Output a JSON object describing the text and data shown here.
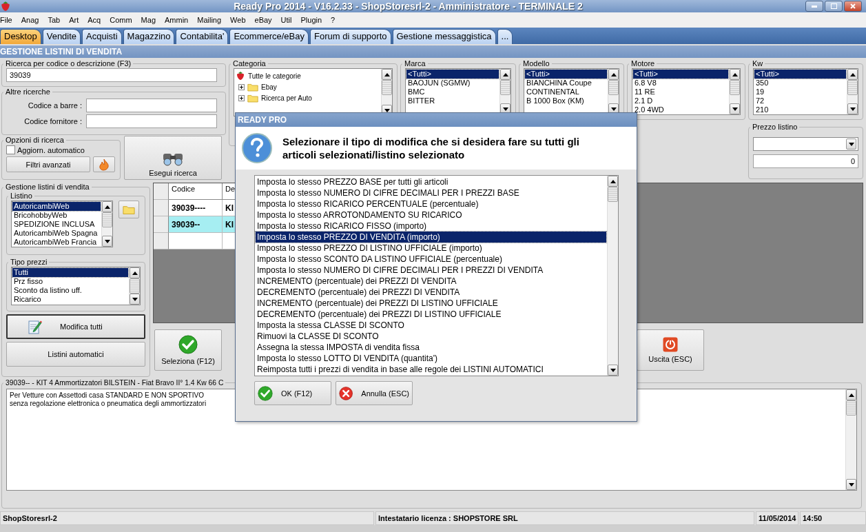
{
  "window": {
    "title": "Ready Pro 2014 - V16.2.33 - ShopStoresrl-2 - Amministratore - TERMINALE 2"
  },
  "menu": [
    "File",
    "Anag",
    "Tab",
    "Art",
    "Acq",
    "Comm",
    "Mag",
    "Ammin",
    "Mailing",
    "Web",
    "eBay",
    "Util",
    "Plugin",
    "?"
  ],
  "tabs": [
    {
      "label": "Desktop",
      "selected": true
    },
    {
      "label": "Vendite",
      "selected": false
    },
    {
      "label": "Acquisti",
      "selected": false
    },
    {
      "label": "Magazzino",
      "selected": false
    },
    {
      "label": "Contabilita'",
      "selected": false
    },
    {
      "label": "Ecommerce/eBay",
      "selected": false
    },
    {
      "label": "Forum di supporto",
      "selected": false
    },
    {
      "label": "Gestione messaggistica",
      "selected": false
    },
    {
      "label": "...",
      "selected": false
    }
  ],
  "section_title": "GESTIONE LISTINI DI VENDITA",
  "search": {
    "label": "Ricerca per codice o descrizione (F3)",
    "value": "39039"
  },
  "other_searches": {
    "label": "Altre ricerche",
    "fields": [
      {
        "label": "Codice a barre :"
      },
      {
        "label": "Codice fornitore :"
      }
    ]
  },
  "search_options": {
    "label": "Opzioni di ricerca",
    "auto_update": {
      "label": "Aggiorn. automatico",
      "checked": false
    },
    "advanced_filters_button": "Filtri avanzati"
  },
  "run_search_button": "Esegui ricerca",
  "category": {
    "label": "Categoria",
    "root": "Tutte le categorie",
    "children": [
      {
        "label": "Ebay"
      },
      {
        "label": "Ricerca per Auto"
      }
    ]
  },
  "filters": [
    {
      "label": "Marca",
      "items": [
        {
          "label": "<Tutti>",
          "selected": true
        },
        {
          "label": "BAOJUN (SGMW)",
          "selected": false
        },
        {
          "label": "BMC",
          "selected": false
        },
        {
          "label": "BITTER",
          "selected": false
        }
      ]
    },
    {
      "label": "Modello",
      "items": [
        {
          "label": "<Tutti>",
          "selected": true
        },
        {
          "label": "BIANCHINA Coupe",
          "selected": false
        },
        {
          "label": "CONTINENTAL",
          "selected": false
        },
        {
          "label": "B 1000 Box (KM)",
          "selected": false
        }
      ]
    },
    {
      "label": "Motore",
      "items": [
        {
          "label": "<Tutti>",
          "selected": true
        },
        {
          "label": "6.8 V8",
          "selected": false
        },
        {
          "label": "11 RE",
          "selected": false
        },
        {
          "label": "2.1 D",
          "selected": false
        },
        {
          "label": "2.0 4WD",
          "selected": false
        }
      ]
    },
    {
      "label": "Kw",
      "items": [
        {
          "label": "<Tutti>",
          "selected": true
        },
        {
          "label": "350",
          "selected": false
        },
        {
          "label": "19",
          "selected": false
        },
        {
          "label": "72",
          "selected": false
        },
        {
          "label": "210",
          "selected": false
        }
      ]
    }
  ],
  "list_price": {
    "label": "Prezzo listino",
    "value": "0"
  },
  "price_lists": {
    "label": "Gestione listini di vendita",
    "listino": {
      "label": "Listino",
      "items": [
        {
          "label": "AutoricambiWeb",
          "selected": true
        },
        {
          "label": "BricohobbyWeb",
          "selected": false
        },
        {
          "label": "SPEDIZIONE INCLUSA",
          "selected": false
        },
        {
          "label": "AutoricambiWeb Spagna",
          "selected": false
        },
        {
          "label": "AutoricambiWeb Francia",
          "selected": false
        }
      ]
    },
    "price_types": {
      "label": "Tipo prezzi",
      "items": [
        {
          "label": "Tutti",
          "selected": true
        },
        {
          "label": "Prz fisso",
          "selected": false
        },
        {
          "label": "Sconto da listino uff.",
          "selected": false
        },
        {
          "label": "Ricarico",
          "selected": false
        }
      ]
    },
    "edit_all_button": "Modifica tutti",
    "auto_lists_button": "Listini automatici"
  },
  "table": {
    "columns": [
      "Codice",
      "De"
    ],
    "rows": [
      {
        "cells": [
          "39039----",
          "KI"
        ],
        "selected": false
      },
      {
        "cells": [
          "39039--",
          "KI"
        ],
        "selected": true
      }
    ]
  },
  "select_button": "Seleziona (F12)",
  "exit_button": "Uscita (ESC)",
  "description": {
    "label": "39039-- - KIT 4 Ammortizzatori BILSTEIN - Fiat Bravo II° 1.4 Kw 66 C",
    "lines": [
      "Per Vetture con Assettodi casa STANDARD E NON SPORTIVO",
      "senza regolazione elettronica o pneumatica degli ammortizzatori"
    ]
  },
  "status_bar": [
    "ShopStoresrl-2",
    "Intestatario licenza : SHOPSTORE SRL",
    "11/05/2014",
    "14:50"
  ],
  "dialog": {
    "title": "READY PRO",
    "message": "Selezionare il tipo di modifica che si desidera fare su tutti gli articoli selezionati/listino selezionato",
    "options": [
      {
        "label": "Imposta lo stesso PREZZO BASE per tutti gli articoli",
        "selected": false
      },
      {
        "label": "Imposta lo stesso NUMERO DI CIFRE DECIMALI PER I PREZZI BASE",
        "selected": false
      },
      {
        "label": "Imposta lo stesso RICARICO PERCENTUALE (percentuale)",
        "selected": false
      },
      {
        "label": "Imposta lo stesso ARROTONDAMENTO SU RICARICO",
        "selected": false
      },
      {
        "label": "Imposta lo stesso RICARICO FISSO (importo)",
        "selected": false
      },
      {
        "label": "Imposta lo stesso PREZZO DI VENDITA (importo)",
        "selected": true
      },
      {
        "label": "Imposta lo stesso PREZZO DI LISTINO UFFICIALE (importo)",
        "selected": false
      },
      {
        "label": "Imposta lo stesso SCONTO DA LISTINO UFFICIALE (percentuale)",
        "selected": false
      },
      {
        "label": "Imposta lo stesso NUMERO DI CIFRE DECIMALI PER I PREZZI DI VENDITA",
        "selected": false
      },
      {
        "label": "INCREMENTO (percentuale) dei PREZZI DI VENDITA",
        "selected": false
      },
      {
        "label": "DECREMENTO (percentuale) dei PREZZI DI VENDITA",
        "selected": false
      },
      {
        "label": "INCREMENTO (percentuale) dei PREZZI DI LISTINO UFFICIALE",
        "selected": false
      },
      {
        "label": "DECREMENTO (percentuale) dei PREZZI DI LISTINO UFFICIALE",
        "selected": false
      },
      {
        "label": "Imposta la stessa CLASSE DI SCONTO",
        "selected": false
      },
      {
        "label": "Rimuovi la CLASSE DI SCONTO",
        "selected": false
      },
      {
        "label": "Assegna la stessa IMPOSTA di vendita fissa",
        "selected": false
      },
      {
        "label": "Imposta lo stesso LOTTO DI VENDITA (quantita')",
        "selected": false
      },
      {
        "label": "Reimposta tutti i prezzi di vendita in base alle regole dei LISTINI AUTOMATICI",
        "selected": false
      }
    ],
    "buttons": [
      {
        "label": "OK (F12)",
        "kind": "ok"
      },
      {
        "label": "Annulla (ESC)",
        "kind": "cancel"
      }
    ]
  }
}
